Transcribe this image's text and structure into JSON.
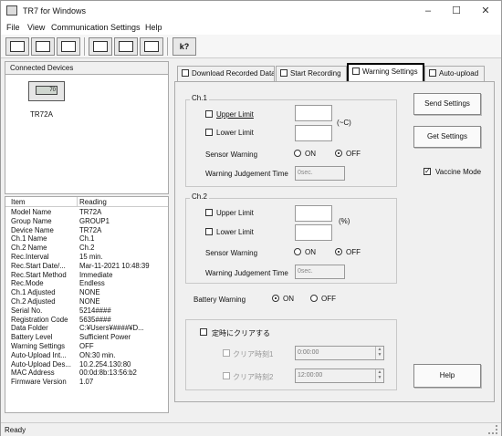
{
  "window": {
    "title": "TR7 for Windows",
    "minimize": "–",
    "maximize": "☐",
    "close": "✕"
  },
  "menu": [
    "File",
    "View",
    "Communication",
    "Settings",
    "Help"
  ],
  "toolbar": {
    "icons": [
      "record-icon",
      "device-info-icon",
      "device-settings-icon",
      "now-icon",
      "grid-icon",
      "help-icon"
    ],
    "help_glyph": "k?"
  },
  "left": {
    "connected_devices_label": "Connected Devices",
    "device_name": "TR72A",
    "device_screen": "70",
    "table": {
      "headers": [
        "Item",
        "Reading"
      ],
      "rows": [
        [
          "Model Name",
          "TR72A"
        ],
        [
          "Group Name",
          "GROUP1"
        ],
        [
          "Device Name",
          "TR72A"
        ],
        [
          "Ch.1 Name",
          "Ch.1"
        ],
        [
          "Ch.2 Name",
          "Ch.2"
        ],
        [
          "Rec.Interval",
          "15 min."
        ],
        [
          "Rec.Start Date/...",
          "Mar-11-2021 10:48:39"
        ],
        [
          "Rec.Start Method",
          "Immediate"
        ],
        [
          "Rec.Mode",
          "Endless"
        ],
        [
          "Ch.1 Adjusted",
          "NONE"
        ],
        [
          "Ch.2 Adjusted",
          "NONE"
        ],
        [
          "Serial No.",
          "5214####"
        ],
        [
          "Registration Code",
          "5635####"
        ],
        [
          "Data Folder",
          "C:¥Users¥####¥D..."
        ],
        [
          "Battery Level",
          "Sufficient Power"
        ],
        [
          "Warning Settings",
          "OFF"
        ],
        [
          "Auto-Upload Int...",
          "ON:30 min."
        ],
        [
          "Auto-Upload Des...",
          "10.2.254.130:80"
        ],
        [
          "MAC Address",
          "00:0d:8b:13:56:b2"
        ],
        [
          "Firmware Version",
          "1.07"
        ]
      ]
    }
  },
  "tabs": [
    {
      "label": "Download Recorded Data",
      "icon": "download-icon"
    },
    {
      "label": "Start Recording",
      "icon": "start-recording-icon"
    },
    {
      "label": "Warning Settings",
      "icon": "warning-icon",
      "active": true
    },
    {
      "label": "Auto-upload",
      "icon": "upload-icon"
    }
  ],
  "warning": {
    "ch1": {
      "label": "Ch.1",
      "upper_limit": "Upper Limit",
      "lower_limit": "Lower Limit",
      "unit": "(~C)",
      "sensor_warning": "Sensor Warning",
      "on": "ON",
      "off": "OFF",
      "sensor_warning_value": "OFF",
      "judgement_time": "Warning Judgement Time",
      "judgement_placeholder": "0sec."
    },
    "ch2": {
      "label": "Ch.2",
      "upper_limit": "Upper Limit",
      "lower_limit": "Lower Limit",
      "unit": "(%)",
      "sensor_warning": "Sensor Warning",
      "on": "ON",
      "off": "OFF",
      "sensor_warning_value": "OFF",
      "judgement_time": "Warning Judgement Time",
      "judgement_placeholder": "0sec."
    },
    "battery_warning": {
      "label": "Battery Warning",
      "on": "ON",
      "off": "OFF",
      "value": "ON"
    },
    "clear": {
      "checkbox_label": "定時にクリアする",
      "time1_label": "クリア時刻1",
      "time1_value": "0:00:00",
      "time2_label": "クリア時刻2",
      "time2_value": "12:00:00"
    },
    "send_settings": "Send Settings",
    "get_settings": "Get Settings",
    "vaccine_mode": "Vaccine Mode",
    "vaccine_mode_checked": true,
    "help": "Help"
  },
  "status": {
    "text": "Ready"
  }
}
